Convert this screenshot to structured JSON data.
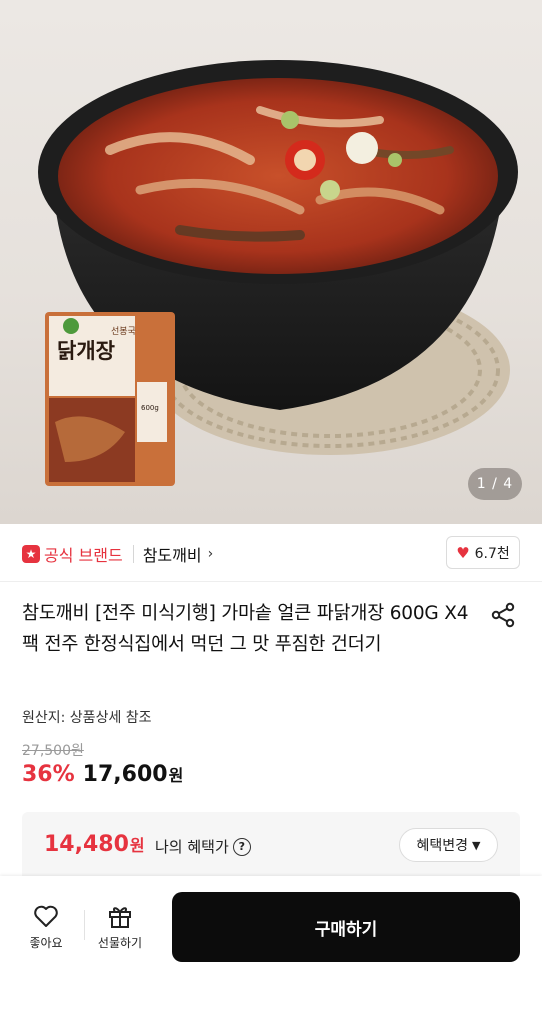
{
  "gallery": {
    "counter": "1 / 4"
  },
  "package": {
    "top_text": "선봉국",
    "name": "닭개장",
    "weight": "600g"
  },
  "brand": {
    "official_label": "공식 브랜드",
    "name": "참도깨비",
    "like_count": "6.7천"
  },
  "product": {
    "title": "참도깨비 [전주 미식기행] 가마솥 얼큰 파닭개장 600G X4팩 전주 한정식집에서 먹던 그 맛 푸짐한 건더기",
    "origin": "원산지: 상품상세 참조",
    "original_price": "27,500원",
    "discount": "36%",
    "price": "17,600",
    "price_unit": "원"
  },
  "benefit": {
    "price": "14,480",
    "price_unit": "원",
    "label": "나의 혜택가",
    "help": "?",
    "change_button": "혜택변경"
  },
  "bottom_bar": {
    "like_label": "좋아요",
    "gift_label": "선물하기",
    "buy_label": "구매하기"
  },
  "colors": {
    "accent": "#e6333f",
    "buy_button": "#0c0c0c"
  }
}
